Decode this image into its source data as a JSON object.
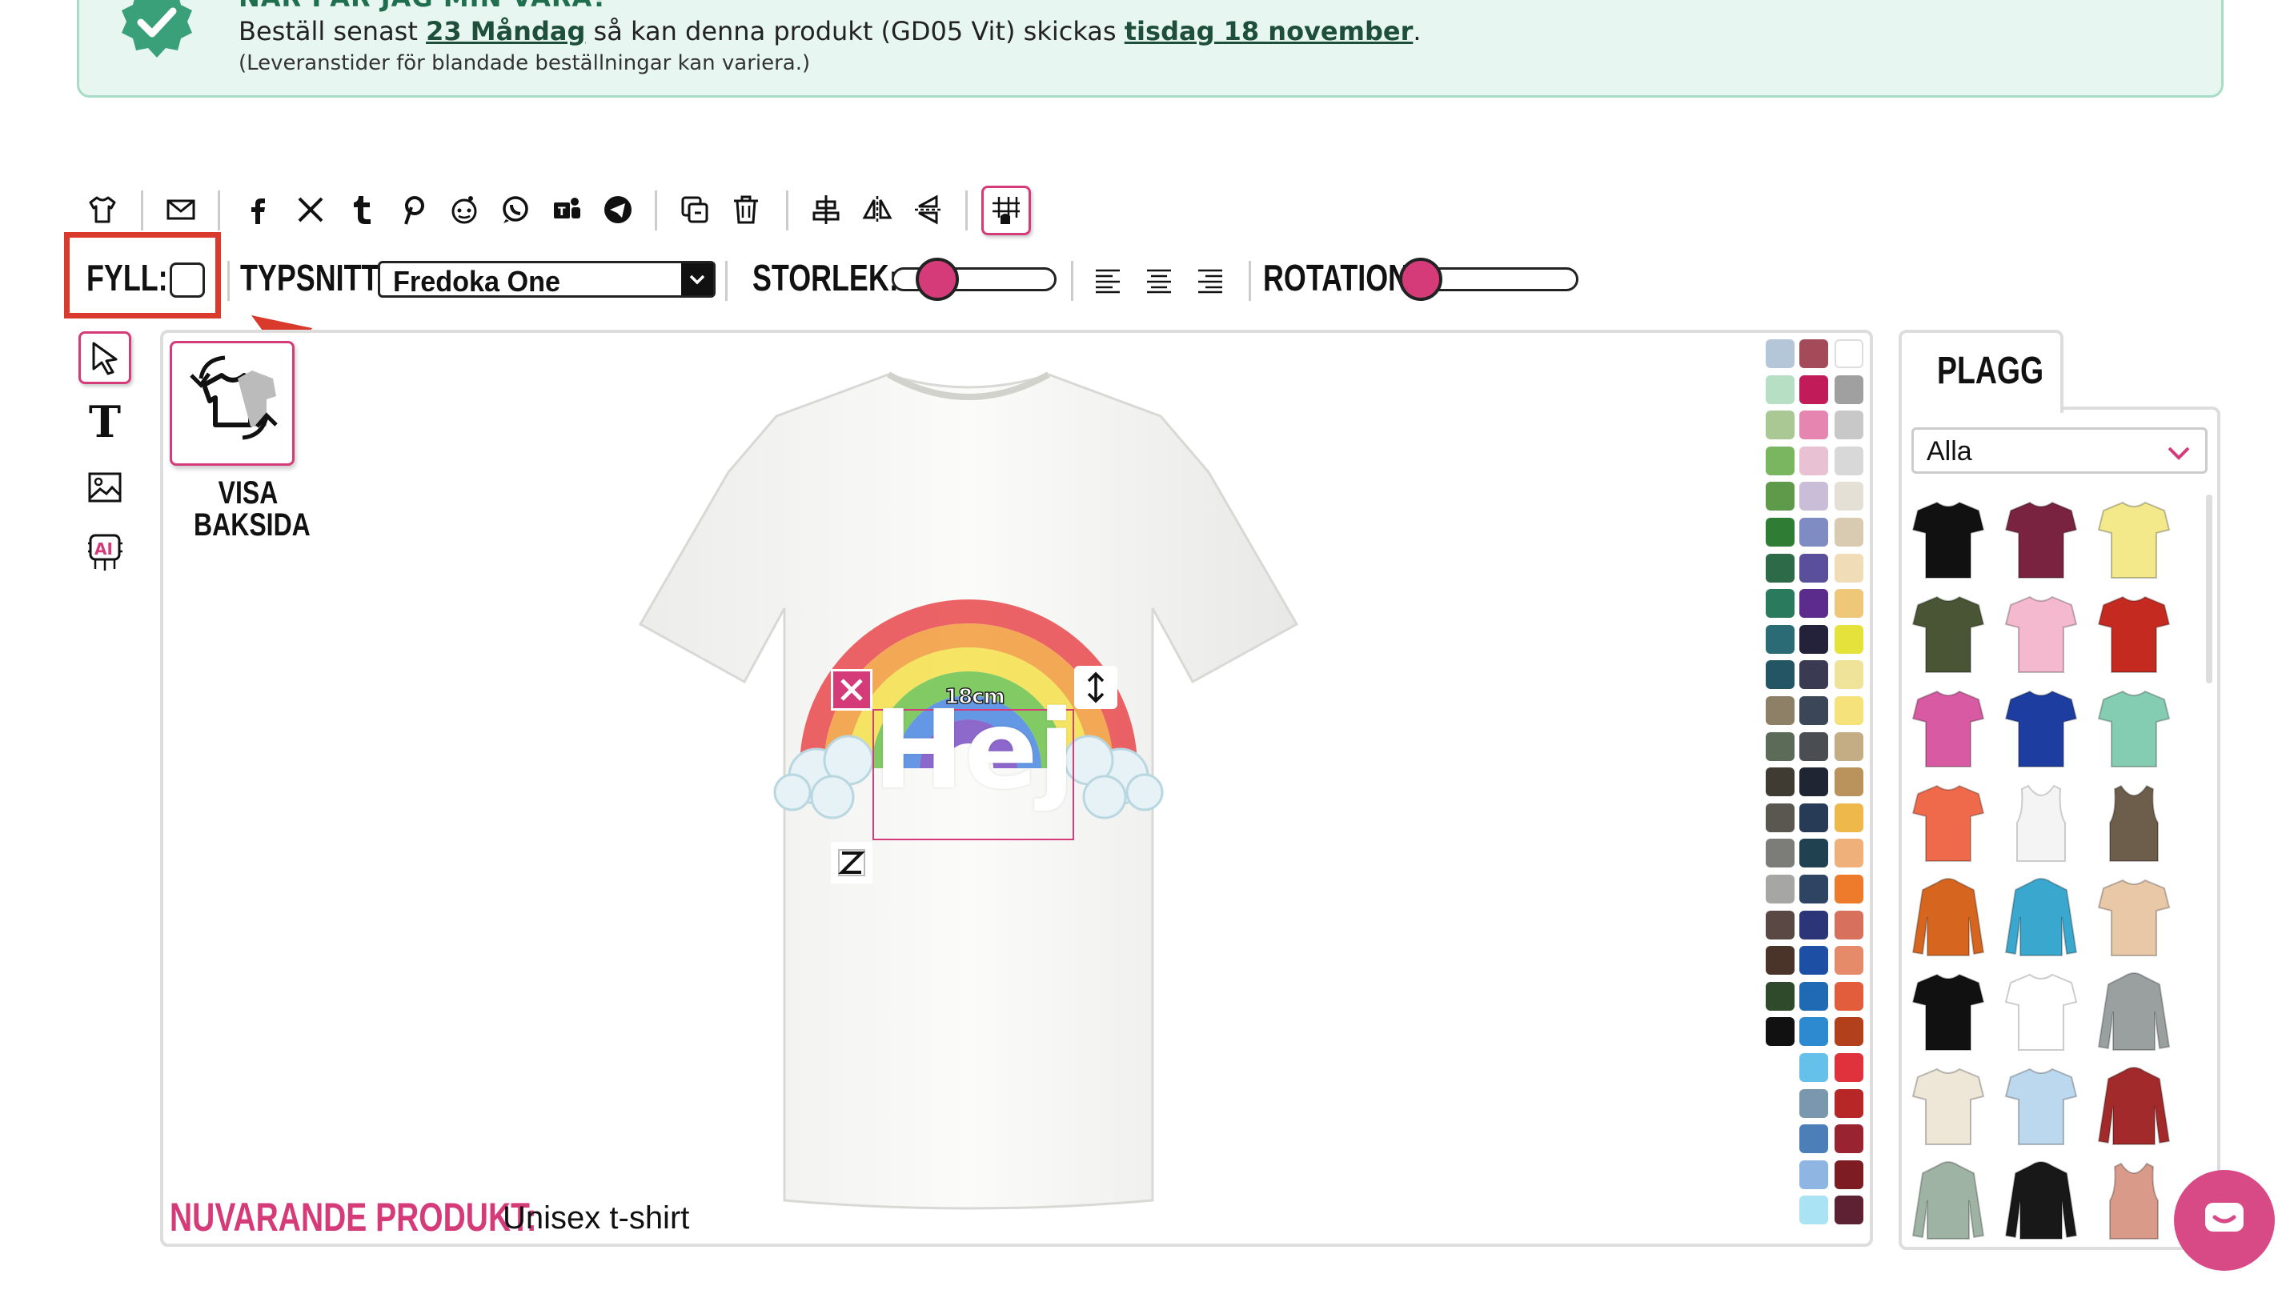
{
  "banner": {
    "title": "NÄR FÅR JAG MIN VARA?",
    "line_pre": "Beställ senast",
    "order_by": "23 Måndag",
    "line_mid": "så kan denna produkt (GD05 Vit) skickas",
    "ship_date": "tisdag 18 november",
    "line_end": ".",
    "note": "(Leveranstider för blandade beställningar kan variera.)"
  },
  "toolbar": {
    "icons": [
      "shirt-icon",
      "mail-icon",
      "facebook-icon",
      "x-icon",
      "tumblr-icon",
      "pinterest-icon",
      "reddit-icon",
      "whatsapp-icon",
      "teams-icon",
      "telegram-icon",
      "duplicate-icon",
      "trash-icon",
      "align-center-icon",
      "flip-horizontal-icon",
      "flip-vertical-icon",
      "grid-icon"
    ]
  },
  "props": {
    "fill_label": "FYLL:",
    "font_label": "TYPSNITT:",
    "font_value": "Fredoka One",
    "size_label": "STORLEK:",
    "rotation_label": "ROTATION:",
    "size_level": 0.2,
    "rotation_level": 0.0
  },
  "side": {
    "back_label_1": "VISA",
    "back_label_2": "BAKSIDA"
  },
  "design": {
    "text": "Hej",
    "width_label": "18cm"
  },
  "current_product": {
    "label": "NUVARANDE PRODUKT:",
    "value": "Unisex t-shirt"
  },
  "panel": {
    "tab": "PLAGG",
    "filter": "Alla"
  },
  "colors": {
    "accent": "#d63b79",
    "highlight_red": "#d93a2b",
    "banner_bg": "#e8f6f1"
  },
  "swatches_col1": [
    "#b3c7d9",
    "#b7dfc3",
    "#aac893",
    "#7ab55f",
    "#5f9a4b",
    "#2f7c34",
    "#2c6a48",
    "#2a7a5e",
    "#2b6b75",
    "#235565",
    "#8d8066",
    "#5b6b58",
    "#3f3a32",
    "#5a5750",
    "#7c7c78",
    "#a6a6a4",
    "#5a4844",
    "#4a3429",
    "#2e4a2a",
    "#111111"
  ],
  "swatches_col2": [
    "#a44b5a",
    "#c21b5a",
    "#e585b0",
    "#e8c2d2",
    "#c9bdd8",
    "#7f8bc3",
    "#5a4f9a",
    "#5b2c8b",
    "#23223a",
    "#3a3a52",
    "#3b4656",
    "#4a4d52",
    "#1f2533",
    "#273a56",
    "#20414f",
    "#2d4563",
    "#2c3577",
    "#1d4fa5",
    "#1f6ab3",
    "#2d8ad1",
    "#66c1ea",
    "#7a98ad",
    "#4c7fb8",
    "#8fb6e3",
    "#a9e3f4"
  ],
  "swatches_col3": [
    "#ffffff",
    "#a0a0a0",
    "#c8c8c8",
    "#d8d8d8",
    "#e5e0d6",
    "#d8cbb2",
    "#f0dcb7",
    "#efc778",
    "#e5e33b",
    "#efe39a",
    "#f6e27a",
    "#c4ad84",
    "#b9935b",
    "#eeb84b",
    "#f0b079",
    "#ee7a2b",
    "#d7705d",
    "#e68b6a",
    "#e25d3b",
    "#b3401c",
    "#e0323c",
    "#b82728",
    "#9a2331",
    "#7d1c22",
    "#5c2234"
  ],
  "garments": [
    "black-tshirt",
    "burgundy-tshirt",
    "yellow-tshirt",
    "olive-tshirt",
    "pink-tshirt",
    "red-tshirt",
    "magenta-tshirt",
    "blue-tshirt",
    "mint-tshirt",
    "coral-tshirt",
    "white-tanktop",
    "brown-tanktop",
    "orange-hoodie",
    "turquoise-hoodie",
    "tiedye-tshirt",
    "black-tshirt-2",
    "raglan-tshirt",
    "grey-hoodie",
    "natural-tshirt",
    "ombre-tshirt",
    "varsity-jacket",
    "sage-longsleeve",
    "black-orange-hoodie",
    "rose-tanktop"
  ],
  "garment_colors": [
    "#111111",
    "#7a2340",
    "#f3e98a",
    "#4a5535",
    "#f4b8cf",
    "#c42a20",
    "#d85aa3",
    "#1d3ea0",
    "#84cdb3",
    "#ef6a4a",
    "#f4f4f4",
    "#6d5e4c",
    "#d6661f",
    "#3aa7cf",
    "#e9c8a8",
    "#111111",
    "#ffffff",
    "#9aa0a0",
    "#eee6d6",
    "#bcd8ee",
    "#a32a2a",
    "#9fb3a5",
    "#181818",
    "#d99a8a"
  ]
}
